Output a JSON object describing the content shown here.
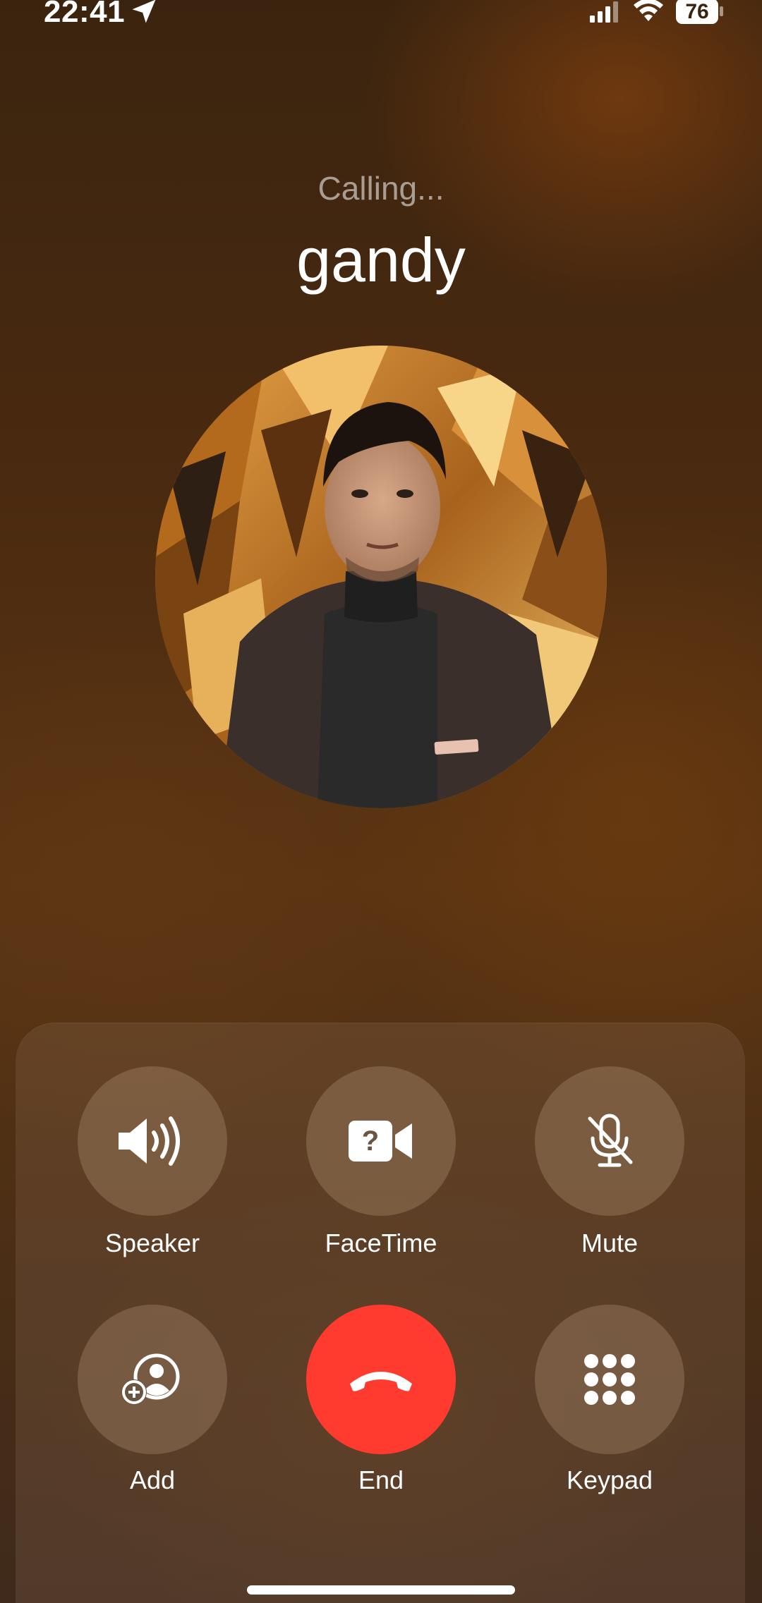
{
  "status_bar": {
    "time": "22:41",
    "battery_level": "76",
    "icons": [
      "location-arrow-icon",
      "signal-icon",
      "wifi-icon",
      "battery-icon"
    ]
  },
  "call": {
    "status": "Calling...",
    "caller_name": "gandy"
  },
  "controls": {
    "speaker": {
      "label": "Speaker",
      "icon": "speaker-icon"
    },
    "facetime": {
      "label": "FaceTime",
      "icon": "facetime-unavailable-icon"
    },
    "mute": {
      "label": "Mute",
      "icon": "mic-off-icon"
    },
    "add": {
      "label": "Add",
      "icon": "add-contact-icon"
    },
    "end": {
      "label": "End",
      "icon": "end-call-icon"
    },
    "keypad": {
      "label": "Keypad",
      "icon": "keypad-icon"
    }
  },
  "colors": {
    "end_button": "#ff3b30",
    "background": "#4a2a10"
  }
}
